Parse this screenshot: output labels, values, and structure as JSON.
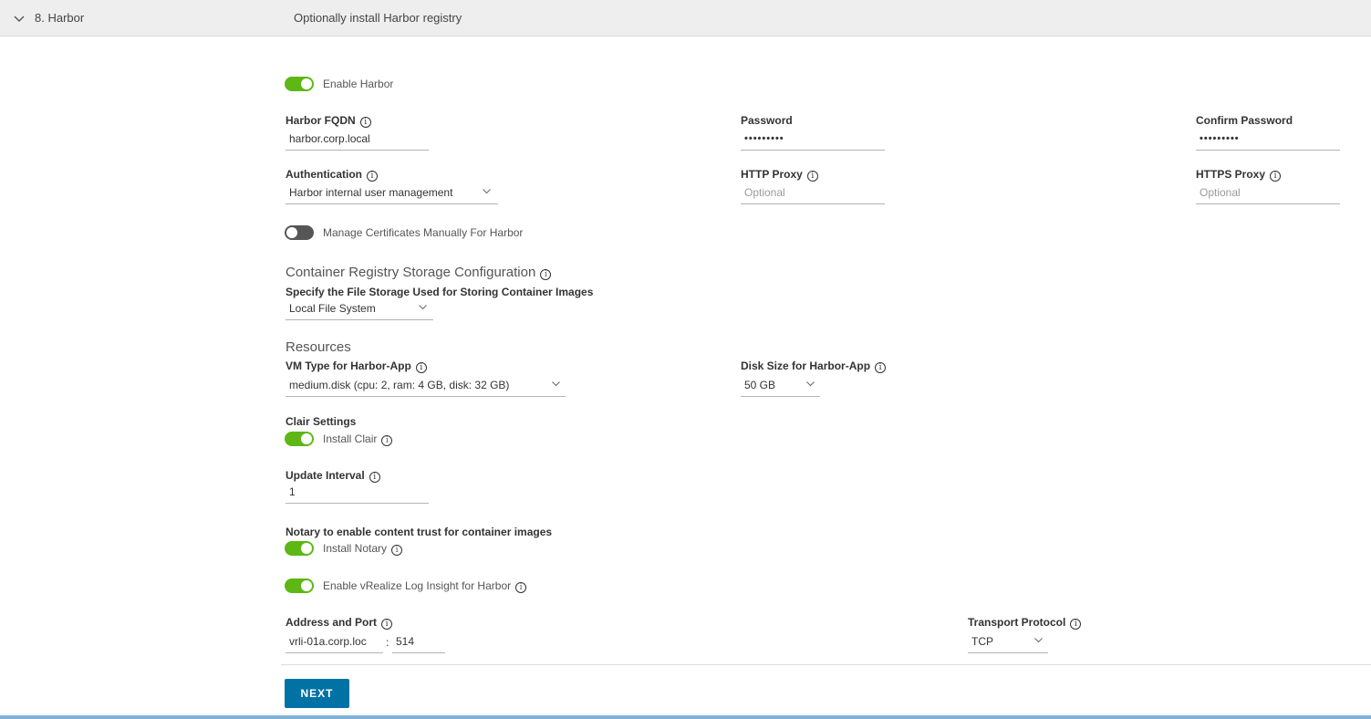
{
  "header": {
    "step_label": "8. Harbor",
    "description": "Optionally install Harbor registry"
  },
  "enable_harbor": {
    "label": "Enable Harbor",
    "state": "on"
  },
  "harbor_fqdn": {
    "label": "Harbor FQDN",
    "value": "harbor.corp.local"
  },
  "password": {
    "label": "Password",
    "value": "•••••••••"
  },
  "confirm_password": {
    "label": "Confirm Password",
    "value": "•••••••••"
  },
  "authentication": {
    "label": "Authentication",
    "value": "Harbor internal user management"
  },
  "http_proxy": {
    "label": "HTTP Proxy",
    "placeholder": "Optional"
  },
  "https_proxy": {
    "label": "HTTPS Proxy",
    "placeholder": "Optional"
  },
  "manage_certs": {
    "label": "Manage Certificates Manually For Harbor",
    "state": "off"
  },
  "storage": {
    "title": "Container Registry Storage Configuration",
    "label": "Specify the File Storage Used for Storing Container Images",
    "value": "Local File System"
  },
  "resources": {
    "title": "Resources",
    "vm_type_label": "VM Type for Harbor-App",
    "vm_type_value": "medium.disk (cpu: 2, ram: 4 GB, disk: 32 GB)",
    "disk_size_label": "Disk Size for Harbor-App",
    "disk_size_value": "50 GB"
  },
  "clair": {
    "heading": "Clair Settings",
    "toggle_label": "Install Clair",
    "state": "on"
  },
  "update_interval": {
    "label": "Update Interval",
    "value": "1"
  },
  "notary": {
    "heading": "Notary to enable content trust for container images",
    "toggle_label": "Install Notary",
    "state": "on"
  },
  "log_insight": {
    "label": "Enable vRealize Log Insight for Harbor",
    "state": "on"
  },
  "address_port": {
    "label": "Address and Port",
    "address_value": "vrli-01a.corp.loc",
    "separator": ":",
    "port_value": "514"
  },
  "transport": {
    "label": "Transport Protocol",
    "value": "TCP"
  },
  "next_button": {
    "label": "NEXT"
  },
  "info_glyph": "i",
  "colors": {
    "toggle_on": "#5eb715",
    "toggle_off": "#565656",
    "primary": "#0072a3"
  }
}
